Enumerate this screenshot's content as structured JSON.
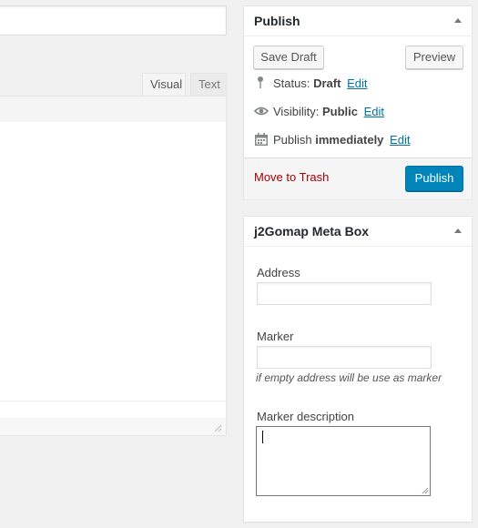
{
  "editor": {
    "tabs": [
      {
        "label": "Visual"
      },
      {
        "label": "Text"
      }
    ]
  },
  "publish_box": {
    "title": "Publish",
    "save_draft_label": "Save Draft",
    "preview_label": "Preview",
    "status": {
      "label": "Status:",
      "value": "Draft",
      "edit": "Edit"
    },
    "visibility": {
      "label": "Visibility:",
      "value": "Public",
      "edit": "Edit"
    },
    "schedule": {
      "label": "Publish",
      "value": "immediately",
      "edit": "Edit"
    },
    "trash_label": "Move to Trash",
    "publish_label": "Publish"
  },
  "meta_box": {
    "title": "j2Gomap Meta Box",
    "address_label": "Address",
    "address_value": "",
    "marker_label": "Marker",
    "marker_value": "",
    "marker_hint": "if empty address will be use as marker",
    "description_label": "Marker description",
    "description_value": ""
  },
  "colors": {
    "accent": "#0085ba",
    "link": "#0073aa",
    "danger": "#a00"
  }
}
